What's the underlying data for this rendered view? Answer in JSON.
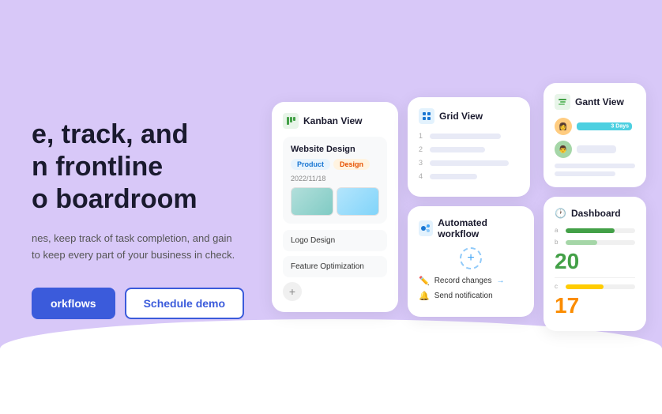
{
  "hero": {
    "title_line1": "e, track, and",
    "title_line2": "n frontline",
    "title_line3": "o boardroom",
    "description_line1": "nes, keep track of task completion, and gain",
    "description_line2": "to keep every part of your business in check.",
    "btn_primary": "orkflows",
    "btn_secondary": "Schedule demo"
  },
  "kanban": {
    "title": "Kanban View",
    "task1_name": "Website Design",
    "tag1": "Product",
    "tag2": "Design",
    "task1_date": "2022/11/18",
    "task2_name": "Logo Design",
    "task3_name": "Feature Optimization",
    "add_label": "+"
  },
  "grid": {
    "title": "Grid View",
    "rows": [
      "1",
      "2",
      "3",
      "4"
    ]
  },
  "gantt": {
    "title": "Gantt View",
    "bar_label": "3 Days"
  },
  "workflow": {
    "title": "Automated workflow",
    "plus": "+",
    "item1_text": "Record changes",
    "item2_text": "Send notification",
    "arrow": "→"
  },
  "dashboard": {
    "title": "Dashboard",
    "number1": "20",
    "number2": "17"
  }
}
